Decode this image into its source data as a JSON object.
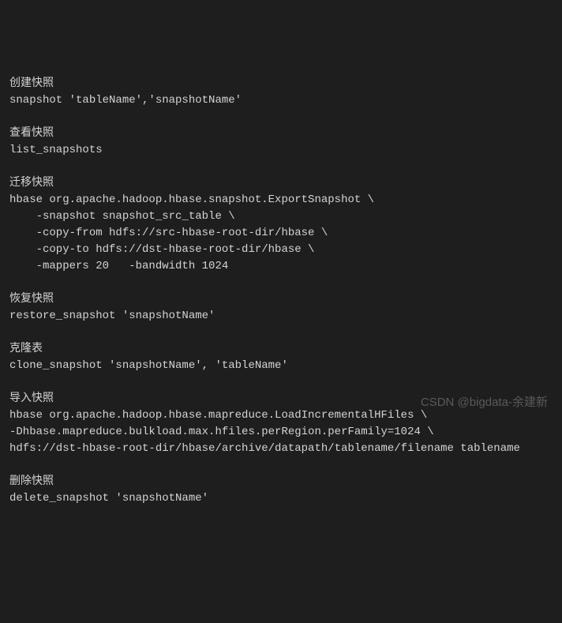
{
  "sections": {
    "s1_title": "创建快照",
    "s1_code": "snapshot 'tableName','snapshotName'",
    "s2_title": "查看快照",
    "s2_code": "list_snapshots",
    "s3_title": "迁移快照",
    "s3_code": "hbase org.apache.hadoop.hbase.snapshot.ExportSnapshot \\\n    -snapshot snapshot_src_table \\\n    -copy-from hdfs://src-hbase-root-dir/hbase \\\n    -copy-to hdfs://dst-hbase-root-dir/hbase \\\n    -mappers 20   -bandwidth 1024",
    "s4_title": "恢复快照",
    "s4_code": "restore_snapshot 'snapshotName'",
    "s5_title": "克隆表",
    "s5_code": "clone_snapshot 'snapshotName', 'tableName'",
    "s6_title": "导入快照",
    "s6_code": "hbase org.apache.hadoop.hbase.mapreduce.LoadIncrementalHFiles \\\n-Dhbase.mapreduce.bulkload.max.hfiles.perRegion.perFamily=1024 \\\nhdfs://dst-hbase-root-dir/hbase/archive/datapath/tablename/filename tablename",
    "s7_title": "删除快照",
    "s7_code": "delete_snapshot 'snapshotName'"
  },
  "watermark": "CSDN @bigdata-余建新"
}
